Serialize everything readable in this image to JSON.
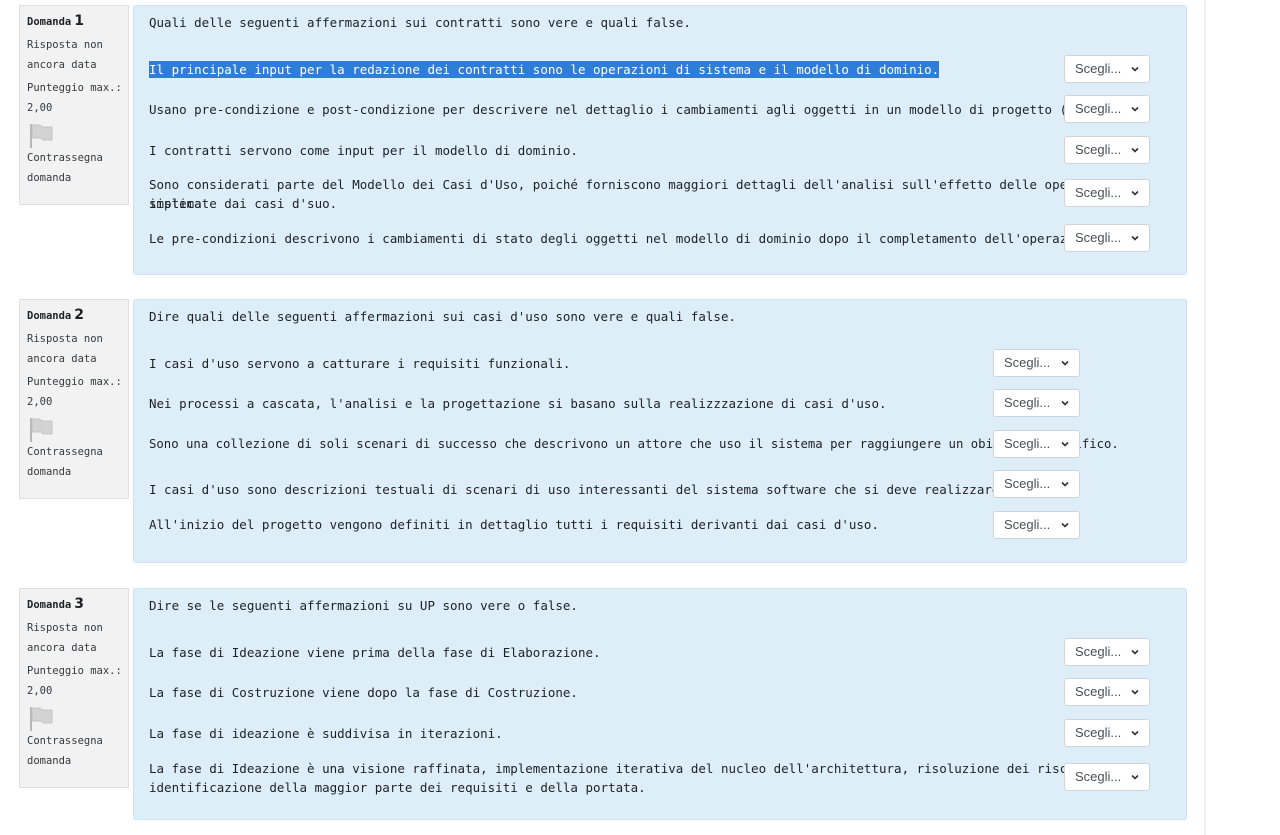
{
  "common": {
    "status": "Risposta non ancora data",
    "status_line1": "Risposta non",
    "status_line2": "ancora data",
    "grade_line1": "Punteggio max.:",
    "grade_line2": "2,00",
    "flag_line1": "Contrassegna",
    "flag_line2": "domanda",
    "question_word": "Domanda",
    "select_value": "Scegli..."
  },
  "questions": [
    {
      "number": "1",
      "text": "Quali delle seguenti affermazioni sui contratti sono vere e quali false.",
      "statements": [
        {
          "text": "Il principale input per la redazione dei contratti sono le operazioni di sistema e il modello di dominio.",
          "answer": "Scegli..."
        },
        {
          "text": "Usano pre-condizione e post-condizione per descrivere nel dettaglio i cambiamenti agli oggetti in un modello di progetto (software).",
          "answer": "Scegli..."
        },
        {
          "text": "I contratti servono come input per il modello di dominio.",
          "answer": "Scegli..."
        },
        {
          "text_line1": "Sono considerati parte del Modello dei Casi d'Uso, poiché forniscono maggiori dettagli dell'analisi sull'effetto delle operazioni di sistema",
          "text_line2": "implicate dai casi d'suo.",
          "answer": "Scegli..."
        },
        {
          "text": "Le pre-condizioni descrivono i cambiamenti di stato degli oggetti nel modello di dominio dopo il completamento dell'operazione.",
          "answer": "Scegli..."
        }
      ]
    },
    {
      "number": "2",
      "text": "Dire quali delle seguenti affermazioni sui casi d'uso sono vere e quali false.",
      "statements": [
        {
          "text": "I casi d'uso servono a catturare i requisiti funzionali.",
          "answer": "Scegli..."
        },
        {
          "text": "Nei processi a cascata, l'analisi e la progettazione si basano sulla realizzzazione di casi d'uso.",
          "answer": "Scegli..."
        },
        {
          "text": "Sono una collezione di soli scenari di successo che descrivono un attore che uso il sistema per raggiungere un obiettivo specifico.",
          "answer": "Scegli..."
        },
        {
          "text": "I casi d'uso sono descrizioni testuali di scenari di uso interessanti del sistema software che si deve realizzare.",
          "answer": "Scegli..."
        },
        {
          "text": "All'inizio del progetto vengono definiti in dettaglio tutti i requisiti derivanti dai casi d'uso.",
          "answer": "Scegli..."
        }
      ]
    },
    {
      "number": "3",
      "text": "Dire se le seguenti affermazioni su UP sono vere o false.",
      "statements": [
        {
          "text": "La fase di Ideazione viene prima della fase di Elaborazione.",
          "answer": "Scegli..."
        },
        {
          "text": "La fase di Costruzione viene dopo la fase di Costruzione.",
          "answer": "Scegli..."
        },
        {
          "text": "La fase di ideazione è suddivisa in iterazioni.",
          "answer": "Scegli..."
        },
        {
          "text_line1": "La fase di Ideazione è una visione raffinata, implementazione iterativa del nucleo dell'architettura, risoluzione dei risci maggiori,",
          "text_line2": "identificazione della maggior parte dei requisiti e della portata.",
          "answer": "Scegli..."
        }
      ]
    }
  ]
}
